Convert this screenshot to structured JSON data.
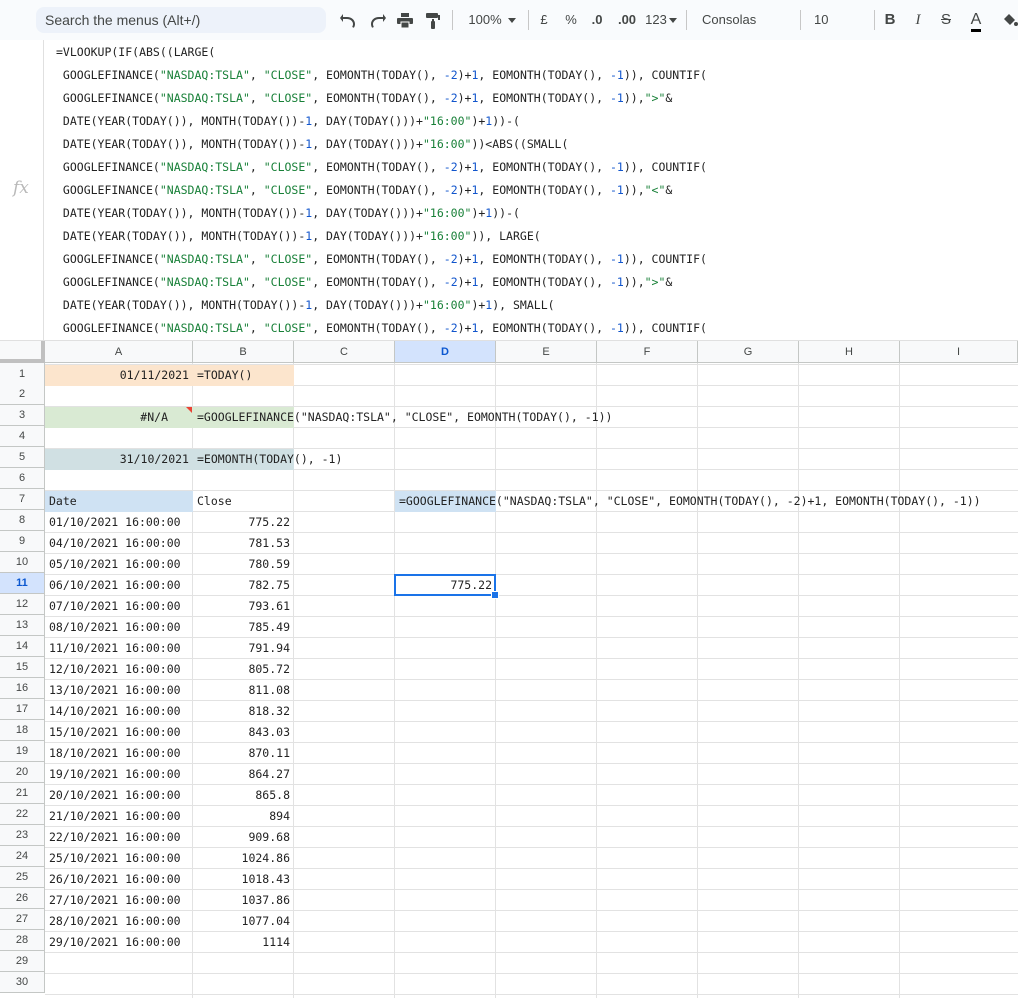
{
  "toolbar": {
    "search_placeholder": "Search the menus (Alt+/)",
    "zoom": "100%",
    "currency": "£",
    "percent": "%",
    "dec_decrease": ".0",
    "dec_increase": ".00",
    "format_more": "123",
    "font": "Consolas",
    "font_size": "10",
    "bold": "B",
    "italic": "I",
    "strike": "S",
    "text_color": "A"
  },
  "formula_bar": {
    "fx": "fx",
    "lines": [
      [
        [
          "t",
          "=VLOOKUP(IF(ABS((LARGE("
        ]
      ],
      [
        [
          "t",
          " GOOGLEFINANCE("
        ],
        [
          "s",
          "\"NASDAQ:TSLA\""
        ],
        [
          "t",
          ", "
        ],
        [
          "s",
          "\"CLOSE\""
        ],
        [
          "t",
          ", EOMONTH(TODAY(), "
        ],
        [
          "n",
          "-2"
        ],
        [
          "t",
          ")+"
        ],
        [
          "n",
          "1"
        ],
        [
          "t",
          ", EOMONTH(TODAY(), "
        ],
        [
          "n",
          "-1"
        ],
        [
          "t",
          ")), COUNTIF("
        ]
      ],
      [
        [
          "t",
          " GOOGLEFINANCE("
        ],
        [
          "s",
          "\"NASDAQ:TSLA\""
        ],
        [
          "t",
          ", "
        ],
        [
          "s",
          "\"CLOSE\""
        ],
        [
          "t",
          ", EOMONTH(TODAY(), "
        ],
        [
          "n",
          "-2"
        ],
        [
          "t",
          ")+"
        ],
        [
          "n",
          "1"
        ],
        [
          "t",
          ", EOMONTH(TODAY(), "
        ],
        [
          "n",
          "-1"
        ],
        [
          "t",
          ")),"
        ],
        [
          "s",
          "\">\""
        ],
        [
          "t",
          "&"
        ]
      ],
      [
        [
          "t",
          " DATE(YEAR(TODAY()), MONTH(TODAY())-"
        ],
        [
          "n",
          "1"
        ],
        [
          "t",
          ", DAY(TODAY()))+"
        ],
        [
          "s",
          "\"16:00\""
        ],
        [
          "t",
          ")+"
        ],
        [
          "n",
          "1"
        ],
        [
          "t",
          "))-("
        ]
      ],
      [
        [
          "t",
          " DATE(YEAR(TODAY()), MONTH(TODAY())-"
        ],
        [
          "n",
          "1"
        ],
        [
          "t",
          ", DAY(TODAY()))+"
        ],
        [
          "s",
          "\"16:00\""
        ],
        [
          "t",
          "))<ABS((SMALL("
        ]
      ],
      [
        [
          "t",
          " GOOGLEFINANCE("
        ],
        [
          "s",
          "\"NASDAQ:TSLA\""
        ],
        [
          "t",
          ", "
        ],
        [
          "s",
          "\"CLOSE\""
        ],
        [
          "t",
          ", EOMONTH(TODAY(), "
        ],
        [
          "n",
          "-2"
        ],
        [
          "t",
          ")+"
        ],
        [
          "n",
          "1"
        ],
        [
          "t",
          ", EOMONTH(TODAY(), "
        ],
        [
          "n",
          "-1"
        ],
        [
          "t",
          ")), COUNTIF("
        ]
      ],
      [
        [
          "t",
          " GOOGLEFINANCE("
        ],
        [
          "s",
          "\"NASDAQ:TSLA\""
        ],
        [
          "t",
          ", "
        ],
        [
          "s",
          "\"CLOSE\""
        ],
        [
          "t",
          ", EOMONTH(TODAY(), "
        ],
        [
          "n",
          "-2"
        ],
        [
          "t",
          ")+"
        ],
        [
          "n",
          "1"
        ],
        [
          "t",
          ", EOMONTH(TODAY(), "
        ],
        [
          "n",
          "-1"
        ],
        [
          "t",
          ")),"
        ],
        [
          "s",
          "\"<\""
        ],
        [
          "t",
          "&"
        ]
      ],
      [
        [
          "t",
          " DATE(YEAR(TODAY()), MONTH(TODAY())-"
        ],
        [
          "n",
          "1"
        ],
        [
          "t",
          ", DAY(TODAY()))+"
        ],
        [
          "s",
          "\"16:00\""
        ],
        [
          "t",
          ")+"
        ],
        [
          "n",
          "1"
        ],
        [
          "t",
          "))-("
        ]
      ],
      [
        [
          "t",
          " DATE(YEAR(TODAY()), MONTH(TODAY())-"
        ],
        [
          "n",
          "1"
        ],
        [
          "t",
          ", DAY(TODAY()))+"
        ],
        [
          "s",
          "\"16:00\""
        ],
        [
          "t",
          ")), LARGE("
        ]
      ],
      [
        [
          "t",
          " GOOGLEFINANCE("
        ],
        [
          "s",
          "\"NASDAQ:TSLA\""
        ],
        [
          "t",
          ", "
        ],
        [
          "s",
          "\"CLOSE\""
        ],
        [
          "t",
          ", EOMONTH(TODAY(), "
        ],
        [
          "n",
          "-2"
        ],
        [
          "t",
          ")+"
        ],
        [
          "n",
          "1"
        ],
        [
          "t",
          ", EOMONTH(TODAY(), "
        ],
        [
          "n",
          "-1"
        ],
        [
          "t",
          ")), COUNTIF("
        ]
      ],
      [
        [
          "t",
          " GOOGLEFINANCE("
        ],
        [
          "s",
          "\"NASDAQ:TSLA\""
        ],
        [
          "t",
          ", "
        ],
        [
          "s",
          "\"CLOSE\""
        ],
        [
          "t",
          ", EOMONTH(TODAY(), "
        ],
        [
          "n",
          "-2"
        ],
        [
          "t",
          ")+"
        ],
        [
          "n",
          "1"
        ],
        [
          "t",
          ", EOMONTH(TODAY(), "
        ],
        [
          "n",
          "-1"
        ],
        [
          "t",
          ")),"
        ],
        [
          "s",
          "\">\""
        ],
        [
          "t",
          "&"
        ]
      ],
      [
        [
          "t",
          " DATE(YEAR(TODAY()), MONTH(TODAY())-"
        ],
        [
          "n",
          "1"
        ],
        [
          "t",
          ", DAY(TODAY()))+"
        ],
        [
          "s",
          "\"16:00\""
        ],
        [
          "t",
          ")+"
        ],
        [
          "n",
          "1"
        ],
        [
          "t",
          "), SMALL("
        ]
      ],
      [
        [
          "t",
          " GOOGLEFINANCE("
        ],
        [
          "s",
          "\"NASDAQ:TSLA\""
        ],
        [
          "t",
          ", "
        ],
        [
          "s",
          "\"CLOSE\""
        ],
        [
          "t",
          ", EOMONTH(TODAY(), "
        ],
        [
          "n",
          "-2"
        ],
        [
          "t",
          ")+"
        ],
        [
          "n",
          "1"
        ],
        [
          "t",
          ", EOMONTH(TODAY(), "
        ],
        [
          "n",
          "-1"
        ],
        [
          "t",
          ")), COUNTIF("
        ]
      ]
    ]
  },
  "columns": [
    "A",
    "B",
    "C",
    "D",
    "E",
    "F",
    "G",
    "H",
    "I"
  ],
  "rows": [
    "1",
    "2",
    "3",
    "4",
    "5",
    "6",
    "7",
    "8",
    "9",
    "10",
    "11",
    "12",
    "13",
    "14",
    "15",
    "16",
    "17",
    "18",
    "19",
    "20",
    "21",
    "22",
    "23",
    "24",
    "25",
    "26",
    "27",
    "28",
    "29",
    "30"
  ],
  "cells": {
    "A1": "01/11/2021",
    "B1": "=TODAY()",
    "A3": "#N/A",
    "B3": "=GOOGLEFINANCE(\"NASDAQ:TSLA\", \"CLOSE\", EOMONTH(TODAY(), -1))",
    "A5": "31/10/2021",
    "B5": "=EOMONTH(TODAY(), -1)",
    "A7": "Date",
    "B7": "Close",
    "D7": "=GOOGLEFINANCE(\"NASDAQ:TSLA\", \"CLOSE\", EOMONTH(TODAY(), -2)+1, EOMONTH(TODAY(), -1))",
    "D11": "775.22"
  },
  "table": [
    [
      "01/10/2021 16:00:00",
      "775.22"
    ],
    [
      "04/10/2021 16:00:00",
      "781.53"
    ],
    [
      "05/10/2021 16:00:00",
      "780.59"
    ],
    [
      "06/10/2021 16:00:00",
      "782.75"
    ],
    [
      "07/10/2021 16:00:00",
      "793.61"
    ],
    [
      "08/10/2021 16:00:00",
      "785.49"
    ],
    [
      "11/10/2021 16:00:00",
      "791.94"
    ],
    [
      "12/10/2021 16:00:00",
      "805.72"
    ],
    [
      "13/10/2021 16:00:00",
      "811.08"
    ],
    [
      "14/10/2021 16:00:00",
      "818.32"
    ],
    [
      "15/10/2021 16:00:00",
      "843.03"
    ],
    [
      "18/10/2021 16:00:00",
      "870.11"
    ],
    [
      "19/10/2021 16:00:00",
      "864.27"
    ],
    [
      "20/10/2021 16:00:00",
      "865.8"
    ],
    [
      "21/10/2021 16:00:00",
      "894"
    ],
    [
      "22/10/2021 16:00:00",
      "909.68"
    ],
    [
      "25/10/2021 16:00:00",
      "1024.86"
    ],
    [
      "26/10/2021 16:00:00",
      "1018.43"
    ],
    [
      "27/10/2021 16:00:00",
      "1037.86"
    ],
    [
      "28/10/2021 16:00:00",
      "1077.04"
    ],
    [
      "29/10/2021 16:00:00",
      "1114"
    ]
  ],
  "colors": {
    "accent": "#1a73e8",
    "cell_orange": "#fce5cd",
    "cell_green": "#d9ead3",
    "cell_blue": "#d0e0e3",
    "header_blue": "#cfe2f3",
    "string_green": "#188038",
    "number_blue": "#1155cc"
  }
}
